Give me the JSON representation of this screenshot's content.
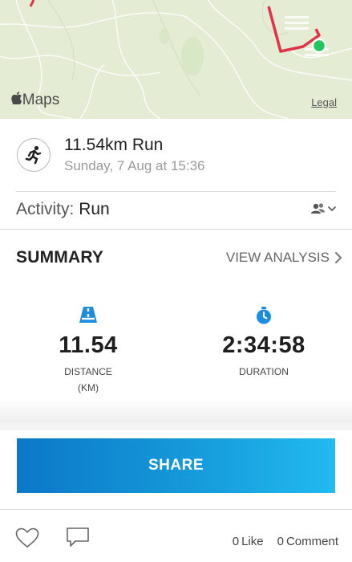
{
  "map": {
    "logo_text": "Maps",
    "legal_label": "Legal",
    "route_color": "#e0334a",
    "end_marker_color": "#22c55e",
    "background_color": "#e4ecd3"
  },
  "activity": {
    "icon": "running-person-icon",
    "title": "11.54km Run",
    "date": "Sunday, 7 Aug at 15:36",
    "type_label": "Activity:",
    "type_value": "Run",
    "people_icon": "people-icon"
  },
  "summary": {
    "title": "SUMMARY",
    "view_analysis_label": "VIEW ANALYSIS",
    "accent_color": "#1c8ee0",
    "distance": {
      "icon": "road-icon",
      "value": "11.54",
      "label": "DISTANCE",
      "unit": "(KM)"
    },
    "duration": {
      "icon": "stopwatch-icon",
      "value": "2:34:58",
      "label": "DURATION"
    }
  },
  "share": {
    "label": "SHARE"
  },
  "social": {
    "like_icon": "heart-icon",
    "comment_icon": "comment-icon",
    "like_count": "0",
    "like_label": "Like",
    "comment_count": "0",
    "comment_label": "Comment"
  }
}
